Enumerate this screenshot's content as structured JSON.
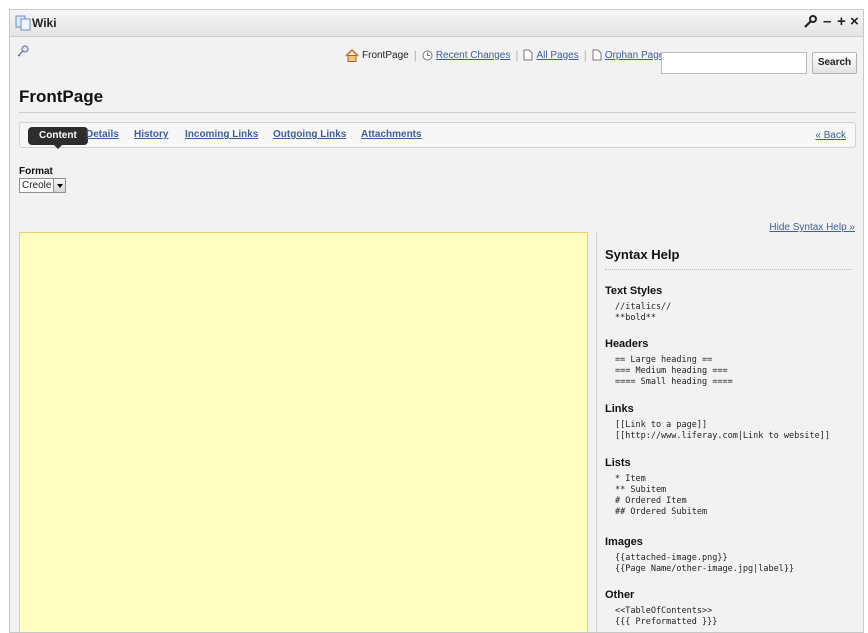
{
  "window": {
    "title": "Wiki",
    "controls": {
      "configure": "⚙",
      "minimize": "–",
      "maximize": "+",
      "close": "×"
    }
  },
  "topnav": {
    "front_page": "FrontPage",
    "recent_changes": "Recent Changes",
    "all_pages": "All Pages",
    "orphan_pages": "Orphan Pages"
  },
  "search": {
    "value": "",
    "placeholder": "",
    "button_label": "Search"
  },
  "page": {
    "title": "FrontPage"
  },
  "tabs": {
    "items": [
      {
        "label": "Content",
        "active": true
      },
      {
        "label": "Details"
      },
      {
        "label": "History"
      },
      {
        "label": "Incoming Links"
      },
      {
        "label": "Outgoing Links"
      },
      {
        "label": "Attachments"
      }
    ],
    "back": "« Back"
  },
  "format": {
    "label": "Format",
    "selected": "Creole"
  },
  "editor": {
    "content": "",
    "background_color": "#ffffc0"
  },
  "syntax_help": {
    "hide_label": "Hide Syntax Help »",
    "title": "Syntax Help",
    "sections": [
      {
        "heading": "Text Styles",
        "code": "//italics//\n**bold**"
      },
      {
        "heading": "Headers",
        "code": "== Large heading ==\n=== Medium heading ===\n==== Small heading ===="
      },
      {
        "heading": "Links",
        "code": "[[Link to a page]]\n[[http://www.liferay.com|Link to website]]"
      },
      {
        "heading": "Lists",
        "code": "* Item\n** Subitem\n# Ordered Item\n## Ordered Subitem"
      },
      {
        "heading": "Images",
        "code": "{{attached-image.png}}\n{{Page Name/other-image.jpg|label}}"
      },
      {
        "heading": "Other",
        "code": "<<TableOfContents>>\n{{{ Preformatted }}}"
      }
    ]
  },
  "colors": {
    "link": "#3d5e9a",
    "active_tab": "#2d2d2d",
    "editor_bg": "#ffffc0"
  }
}
